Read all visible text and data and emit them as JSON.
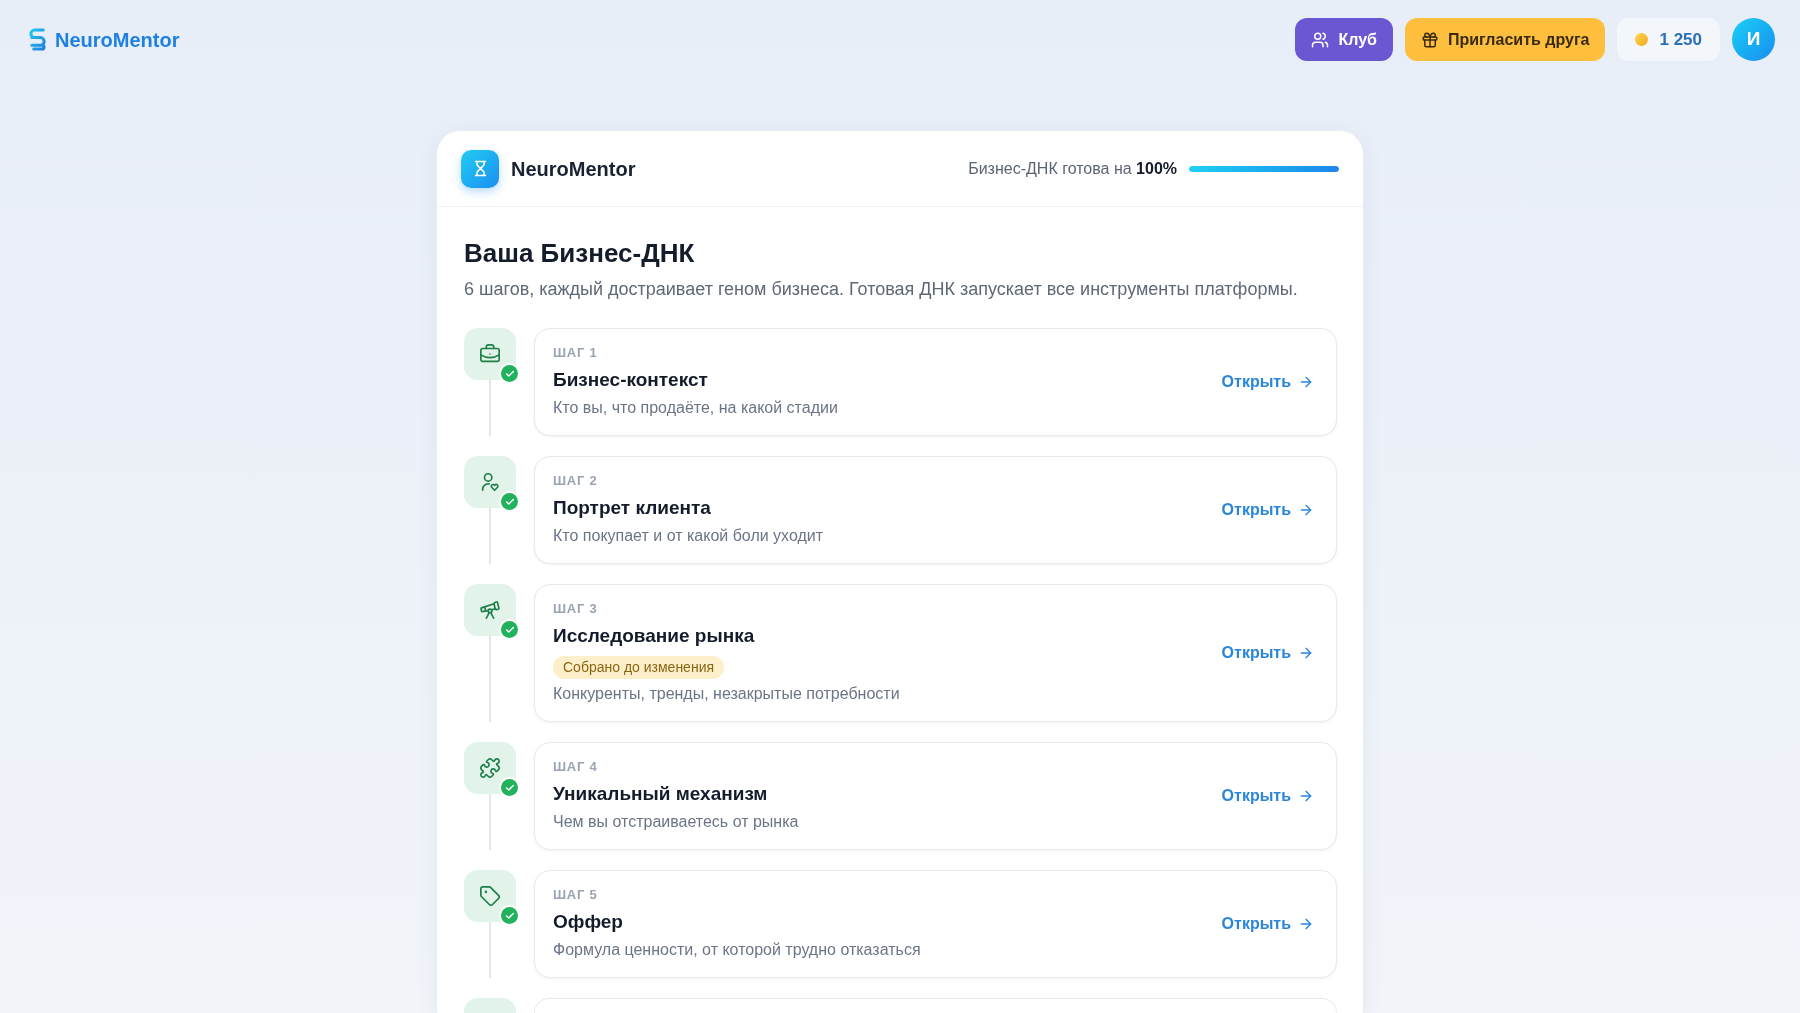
{
  "top_bar": {
    "logo": "NeuroMentor",
    "club_button": {
      "label": "Клуб"
    },
    "invite_button": {
      "label": "Пригласить друга"
    },
    "balance": "1 250",
    "avatar": "И"
  },
  "card_header": {
    "title": "NeuroMentor",
    "progress_label": "Бизнес-ДНК готова на **100%**",
    "progress": {
      "level": 1
    }
  },
  "intro": {
    "title": "Ваша Бизнес-ДНК",
    "subtitle": "6 шагов, каждый достраивает геном бизнеса. Готовая ДНК запускает все инструменты платформы."
  },
  "steps": [
    {
      "kind": "full",
      "label": "ШАГ 1",
      "title": "Бизнес-контекст",
      "description": "Кто вы, что продаёте, на какой стадии",
      "done": true,
      "action": "Открыть"
    },
    {
      "kind": "full",
      "label": "ШАГ 2",
      "title": "Портрет клиента",
      "description": "Кто покупает и от какой боли уходит",
      "done": true,
      "action": "Открыть"
    },
    {
      "kind": "full",
      "label": "ШАГ 3",
      "title": "Исследование рынка",
      "badge": "Собрано до изменения",
      "description": "Конкуренты, тренды, незакрытые потребности",
      "done": true,
      "action": "Открыть"
    },
    {
      "kind": "full",
      "label": "ШАГ 4",
      "title": "Уникальный механизм",
      "description": "Чем вы отстраиваетесь от рынка",
      "done": true,
      "action": "Открыть"
    },
    {
      "kind": "full",
      "label": "ШАГ 5",
      "title": "Оффер",
      "description": "Формула ценности, от которой трудно отказаться",
      "done": true,
      "action": "Открыть"
    },
    {
      "kind": "partial"
    }
  ]
}
